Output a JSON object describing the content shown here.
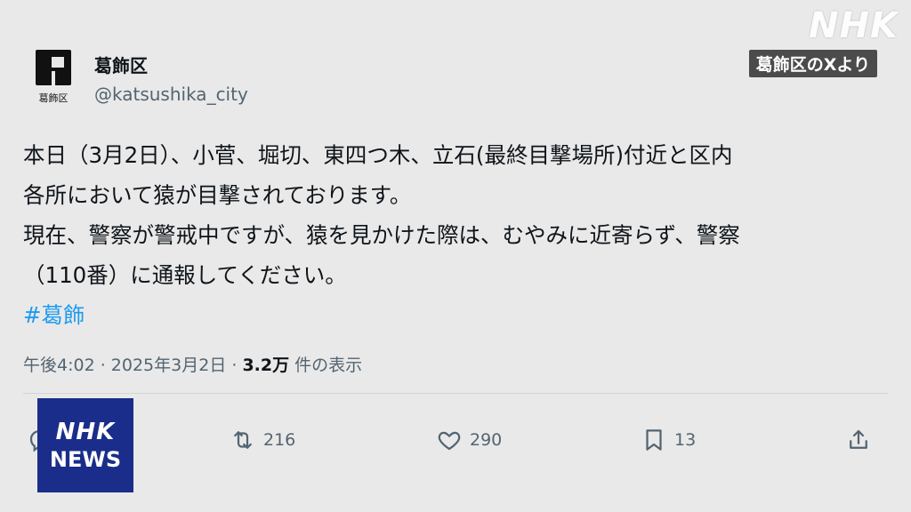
{
  "overlay": {
    "logo": "NHK",
    "source_label": "葛飾区のXより"
  },
  "post": {
    "avatar_caption": "葛飾区",
    "display_name": "葛飾区",
    "handle": "@katsushika_city",
    "lines": [
      "本日（3月2日）、小菅、堀切、東四つ木、立石(最終目撃場所)付近と区内",
      "各所において猿が目撃されております。",
      "現在、警察が警戒中ですが、猿を見かけた際は、むやみに近寄らず、警察",
      "（110番）に通報してください。"
    ],
    "hashtag": "#葛飾",
    "meta_time": "午後4:02 · 2025年3月2日 · ",
    "meta_views": "3.2万",
    "meta_views_suffix": " 件の表示",
    "accent_color": "#1d9bf0"
  },
  "actions": {
    "reply_icon": "reply-icon",
    "retweet_count": "216",
    "like_count": "290",
    "bookmark_count": "13",
    "share_icon": "share-icon"
  },
  "badge": {
    "line1": "NHK",
    "line2": "NEWS",
    "color": "#1a2d8a"
  }
}
